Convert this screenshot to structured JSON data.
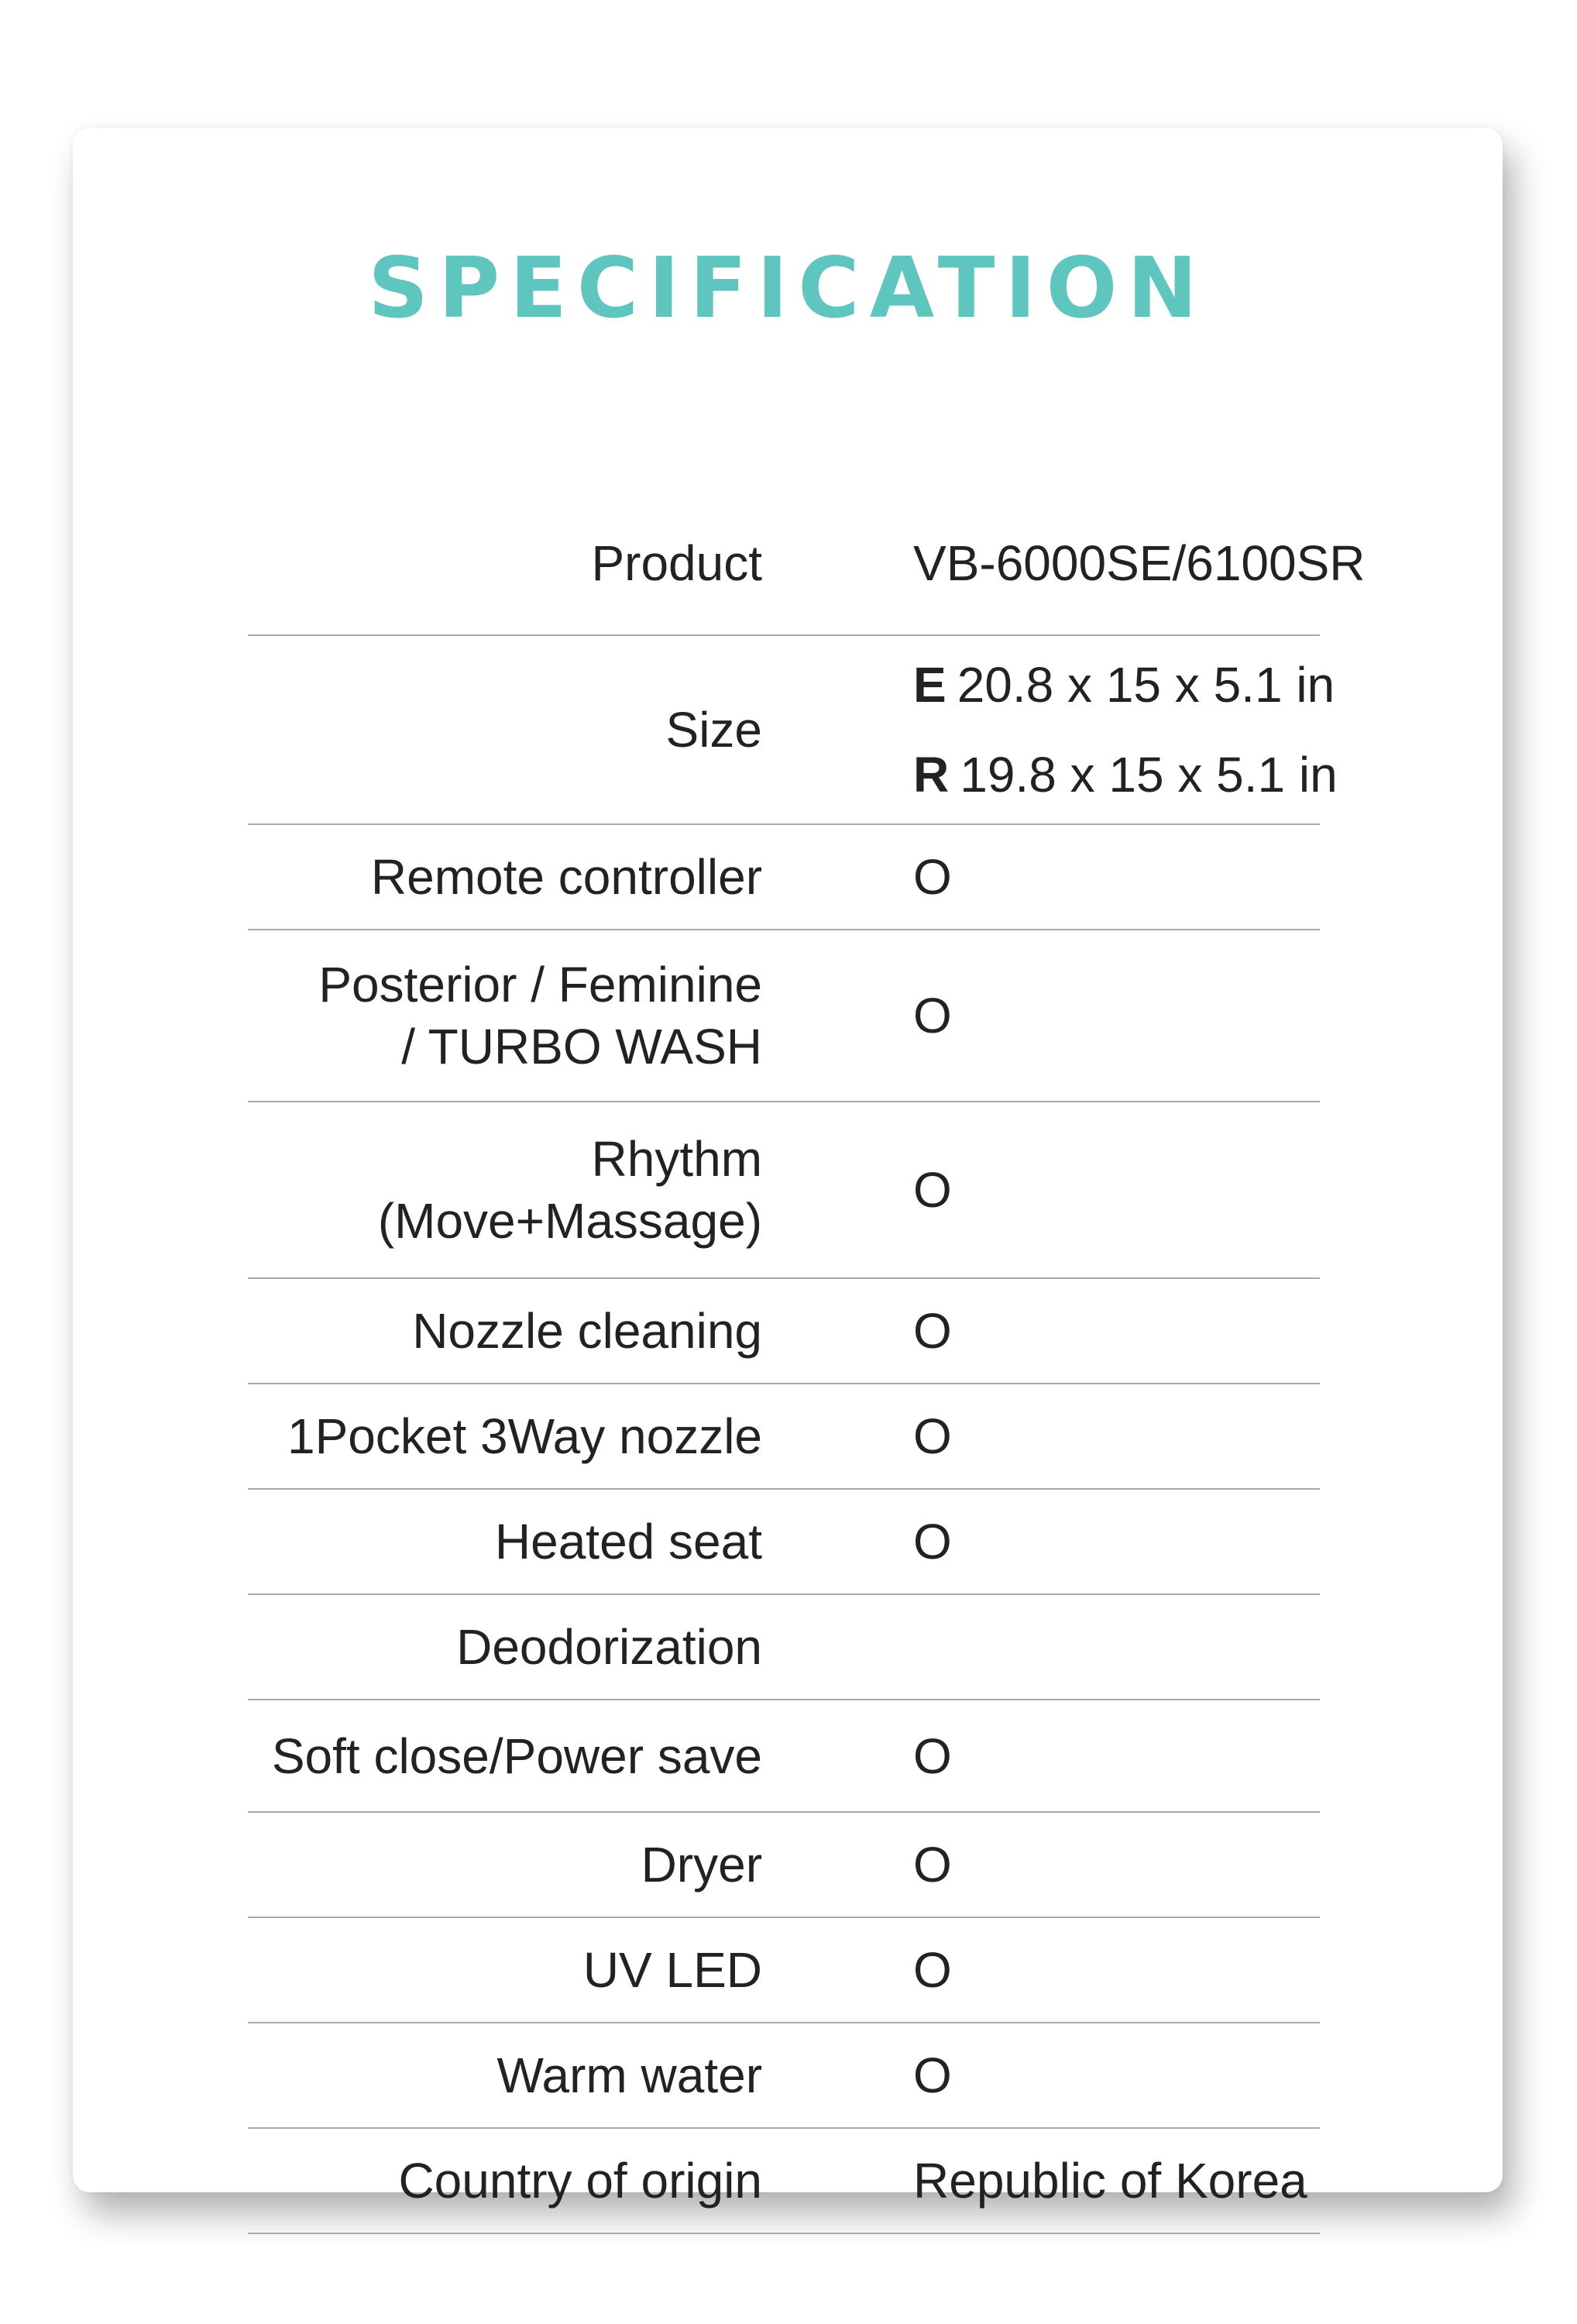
{
  "title": "SPECIFICATION",
  "rows": [
    {
      "label": "Product",
      "value": "VB-6000SE/6100SR"
    },
    {
      "label": "Size",
      "values": [
        {
          "prefix": "E",
          "text": "20.8 x 15 x 5.1 in"
        },
        {
          "prefix": "R",
          "text": "19.8 x 15 x 5.1 in"
        }
      ]
    },
    {
      "label": "Remote controller",
      "value": "O"
    },
    {
      "label_lines": [
        "Posterior / Feminine",
        "/ TURBO WASH"
      ],
      "value": "O"
    },
    {
      "label_lines": [
        "Rhythm",
        "(Move+Massage)"
      ],
      "value": "O"
    },
    {
      "label": "Nozzle cleaning",
      "value": "O"
    },
    {
      "label": "1Pocket 3Way nozzle",
      "value": "O"
    },
    {
      "label": "Heated seat",
      "value": "O"
    },
    {
      "label": "Deodorization",
      "value": ""
    },
    {
      "label": "Soft close/Power save",
      "value": "O"
    },
    {
      "label": "Dryer",
      "value": "O"
    },
    {
      "label": "UV LED",
      "value": "O"
    },
    {
      "label": "Warm water",
      "value": "O"
    },
    {
      "label": "Country of origin",
      "value": "Republic of Korea"
    }
  ]
}
